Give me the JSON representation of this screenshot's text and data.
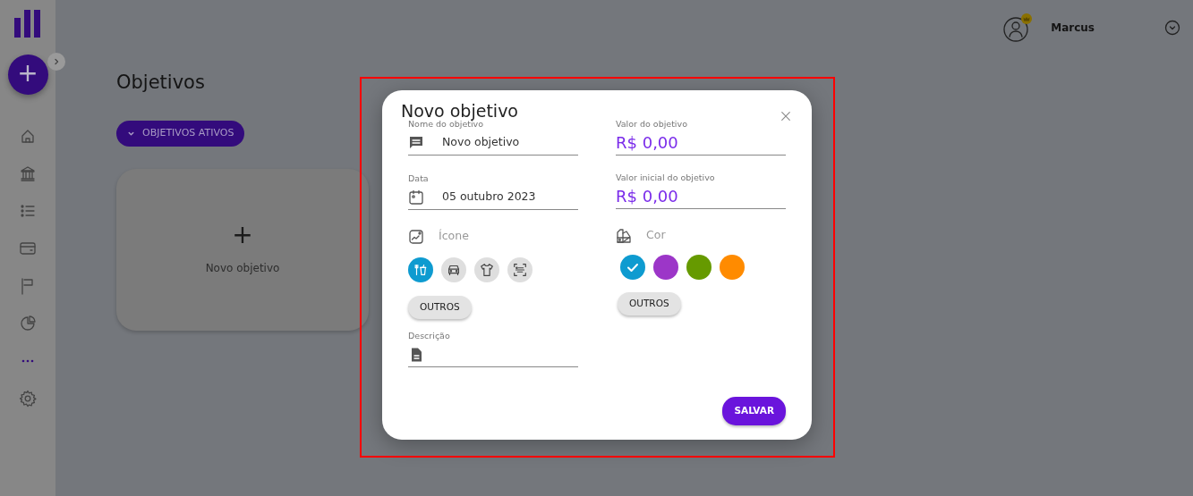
{
  "fab": {
    "symbol": "+"
  },
  "user": {
    "name": "Marcus"
  },
  "page": {
    "title": "Objetivos",
    "filter_button": "OBJETIVOS ATIVOS",
    "new_card": {
      "symbol": "+",
      "label": "Novo objetivo"
    }
  },
  "modal": {
    "title": "Novo objetivo",
    "fields": [
      {
        "kind": "text",
        "label": "Nome do objetivo",
        "value": "Novo objetivo"
      },
      {
        "kind": "date",
        "label": "Data",
        "value": "05 outubro 2023"
      }
    ],
    "icon_section": {
      "label": "Ícone",
      "options": [
        {
          "kind": "food",
          "selected": true
        },
        {
          "kind": "car",
          "selected": false
        },
        {
          "kind": "shirt",
          "selected": false
        },
        {
          "kind": "scan",
          "selected": false
        }
      ],
      "more_button": "OUTROS"
    },
    "description": {
      "label": "Descrição"
    },
    "amounts": [
      {
        "label": "Valor do objetivo",
        "value": "R$ 0,00"
      },
      {
        "label": "Valor inicial do objetivo",
        "value": "R$ 0,00"
      }
    ],
    "color_section": {
      "label": "Cor",
      "options": [
        {
          "color": "#0e9bd0",
          "selected": true
        },
        {
          "color": "#9c36c8",
          "selected": false
        },
        {
          "color": "#669a00",
          "selected": false
        },
        {
          "color": "#ff8b00",
          "selected": false
        }
      ],
      "more_button": "OUTROS"
    },
    "save_button": "SALVAR"
  }
}
